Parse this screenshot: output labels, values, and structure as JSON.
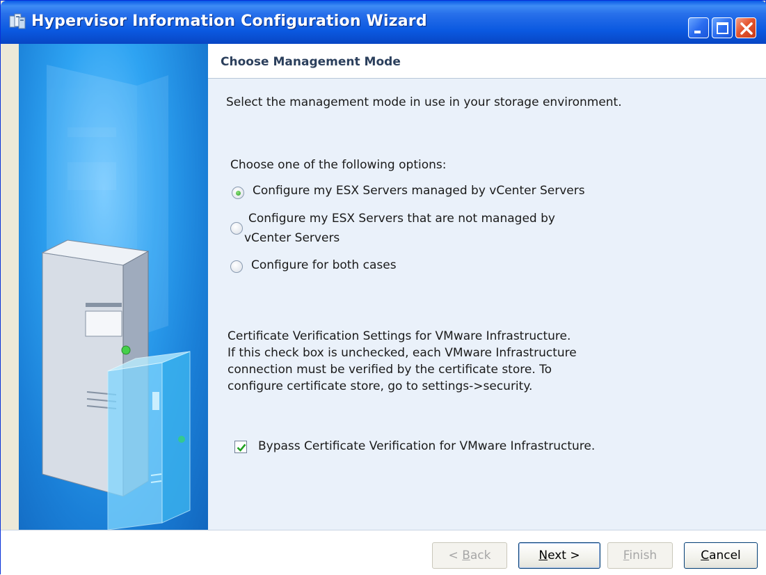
{
  "window": {
    "title": "Hypervisor Information Configuration Wizard"
  },
  "header": {
    "title": "Choose Management Mode"
  },
  "content": {
    "intro": "Select the management mode in use in your storage environment.",
    "options_prompt": "Choose one of the following options:",
    "options": [
      {
        "label": "Configure my ESX Servers managed by vCenter Servers",
        "selected": true
      },
      {
        "label_line1": "Configure my ESX Servers that are not managed by",
        "label_line2": "vCenter Servers",
        "selected": false
      },
      {
        "label": "Configure for both cases",
        "selected": false
      }
    ],
    "cert_text": [
      "Certificate Verification Settings for VMware Infrastructure.",
      "If this check box is unchecked, each VMware Infrastructure",
      "connection must be verified by the certificate store.  To",
      "configure certificate store, go to settings->security."
    ],
    "bypass_checkbox": {
      "label": "Bypass Certificate Verification for VMware Infrastructure.",
      "checked": true
    }
  },
  "footer": {
    "back_prefix": "< ",
    "back_key": "B",
    "back_rest": "ack",
    "next_key": "N",
    "next_rest": "ext >",
    "finish_key": "F",
    "finish_rest": "inish",
    "cancel_key": "C",
    "cancel_rest": "ancel"
  },
  "icons": {
    "app": "servers-icon",
    "minimize": "minimize-icon",
    "maximize": "maximize-icon",
    "close": "close-icon"
  },
  "colors": {
    "titlebar": "#0a58e0",
    "banner": "#2ea3f2",
    "content_bg": "#eaf1fa",
    "header_text": "#2b3f5c"
  }
}
